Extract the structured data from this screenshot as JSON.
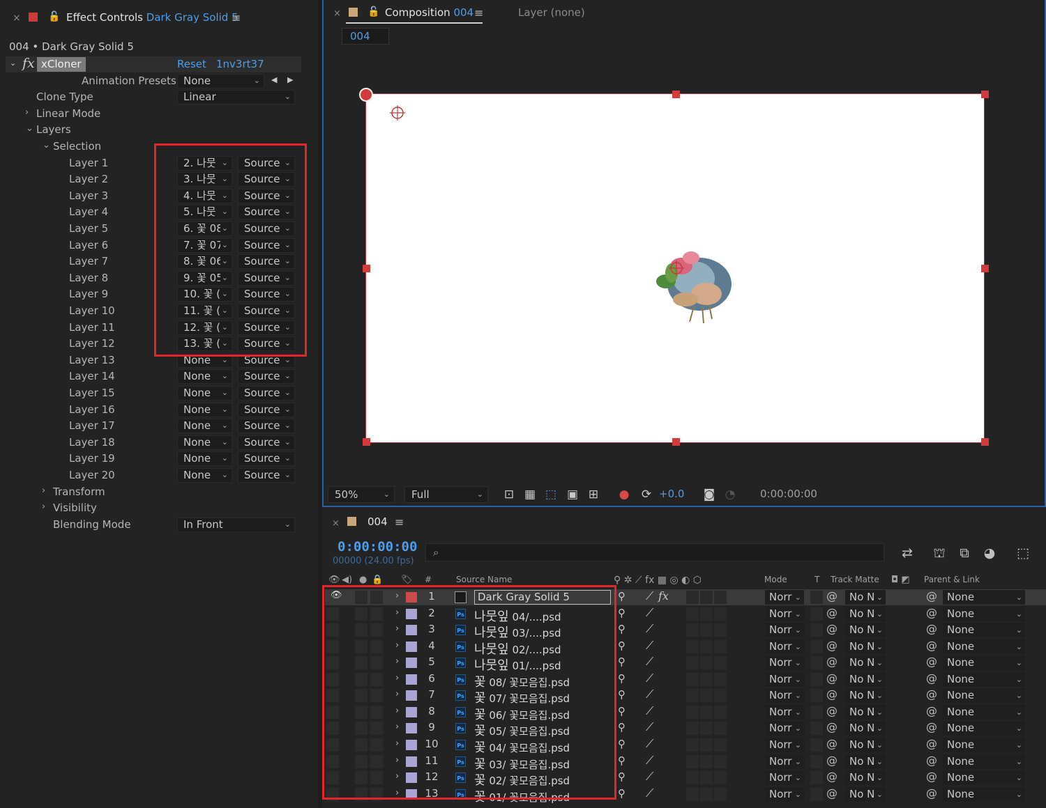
{
  "effect_controls": {
    "close": "×",
    "lock": "🔓",
    "title_prefix": "Effect Controls",
    "title_layer": "Dark Gray Solid 5",
    "menu": "≡",
    "subtitle": "004 • Dark Gray Solid 5",
    "effect": {
      "fx": "fx",
      "name": "xCloner",
      "reset": "Reset",
      "author": "1nv3rt37"
    },
    "animation_presets": {
      "label": "Animation Presets:",
      "value": "None"
    },
    "clone_type": {
      "label": "Clone Type",
      "value": "Linear"
    },
    "linear_mode": "Linear Mode",
    "layers_group": "Layers",
    "selection_group": "Selection",
    "layers": [
      {
        "label": "Layer 1",
        "layer": "2. 나뭇",
        "source": "Source"
      },
      {
        "label": "Layer 2",
        "layer": "3. 나뭇",
        "source": "Source"
      },
      {
        "label": "Layer 3",
        "layer": "4. 나뭇",
        "source": "Source"
      },
      {
        "label": "Layer 4",
        "layer": "5. 나뭇",
        "source": "Source"
      },
      {
        "label": "Layer 5",
        "layer": "6. 꽃 08",
        "source": "Source"
      },
      {
        "label": "Layer 6",
        "layer": "7. 꽃 07",
        "source": "Source"
      },
      {
        "label": "Layer 7",
        "layer": "8. 꽃 06",
        "source": "Source"
      },
      {
        "label": "Layer 8",
        "layer": "9. 꽃 05",
        "source": "Source"
      },
      {
        "label": "Layer 9",
        "layer": "10. 꽃 (",
        "source": "Source"
      },
      {
        "label": "Layer 10",
        "layer": "11. 꽃 (",
        "source": "Source"
      },
      {
        "label": "Layer 11",
        "layer": "12. 꽃 (",
        "source": "Source"
      },
      {
        "label": "Layer 12",
        "layer": "13. 꽃 (",
        "source": "Source"
      },
      {
        "label": "Layer 13",
        "layer": "None",
        "source": "Source"
      },
      {
        "label": "Layer 14",
        "layer": "None",
        "source": "Source"
      },
      {
        "label": "Layer 15",
        "layer": "None",
        "source": "Source"
      },
      {
        "label": "Layer 16",
        "layer": "None",
        "source": "Source"
      },
      {
        "label": "Layer 17",
        "layer": "None",
        "source": "Source"
      },
      {
        "label": "Layer 18",
        "layer": "None",
        "source": "Source"
      },
      {
        "label": "Layer 19",
        "layer": "None",
        "source": "Source"
      },
      {
        "label": "Layer 20",
        "layer": "None",
        "source": "Source"
      }
    ],
    "transform": "Transform",
    "visibility": "Visibility",
    "blending_mode": {
      "label": "Blending Mode",
      "value": "In Front"
    }
  },
  "composition": {
    "close": "×",
    "lock": "🔓",
    "title_prefix": "Composition",
    "title_comp": "004",
    "menu": "≡",
    "layer_tab": "Layer (none)",
    "breadcrumb": "004",
    "zoom": "50%",
    "resolution": "Full",
    "exposure": "+0.0",
    "timecode": "0:00:00:00"
  },
  "timeline": {
    "close": "×",
    "comp_name": "004",
    "menu": "≡",
    "timecode": "0:00:00:00",
    "frame_fps": "00000 (24.00 fps)",
    "search_icon": "⌕",
    "columns": {
      "hash": "#",
      "source_name": "Source Name",
      "mode": "Mode",
      "t": "T",
      "track_matte": "Track Matte",
      "parent_link": "Parent & Link"
    },
    "rows": [
      {
        "num": "1",
        "name": "Dark Gray Solid 5",
        "kind": "solid",
        "mode": "Norr",
        "matte": "No N",
        "parent": "None",
        "label_color": "#c94b4b"
      },
      {
        "num": "2",
        "name_big": "나뭇잎",
        "name": " 04/....psd",
        "kind": "psd",
        "mode": "Norr",
        "matte": "No N",
        "parent": "None",
        "label_color": "#a9a6d6"
      },
      {
        "num": "3",
        "name_big": "나뭇잎",
        "name": " 03/....psd",
        "kind": "psd",
        "mode": "Norr",
        "matte": "No N",
        "parent": "None",
        "label_color": "#a9a6d6"
      },
      {
        "num": "4",
        "name_big": "나뭇잎",
        "name": " 02/....psd",
        "kind": "psd",
        "mode": "Norr",
        "matte": "No N",
        "parent": "None",
        "label_color": "#a9a6d6"
      },
      {
        "num": "5",
        "name_big": "나뭇잎",
        "name": " 01/....psd",
        "kind": "psd",
        "mode": "Norr",
        "matte": "No N",
        "parent": "None",
        "label_color": "#a9a6d6"
      },
      {
        "num": "6",
        "name_big": "꽃",
        "name": " 08/ 꽃모음집.psd",
        "kind": "psd",
        "mode": "Norr",
        "matte": "No N",
        "parent": "None",
        "label_color": "#a9a6d6"
      },
      {
        "num": "7",
        "name_big": "꽃",
        "name": " 07/ 꽃모음집.psd",
        "kind": "psd",
        "mode": "Norr",
        "matte": "No N",
        "parent": "None",
        "label_color": "#a9a6d6"
      },
      {
        "num": "8",
        "name_big": "꽃",
        "name": " 06/ 꽃모음집.psd",
        "kind": "psd",
        "mode": "Norr",
        "matte": "No N",
        "parent": "None",
        "label_color": "#a9a6d6"
      },
      {
        "num": "9",
        "name_big": "꽃",
        "name": " 05/ 꽃모음집.psd",
        "kind": "psd",
        "mode": "Norr",
        "matte": "No N",
        "parent": "None",
        "label_color": "#a9a6d6"
      },
      {
        "num": "10",
        "name_big": "꽃",
        "name": " 04/ 꽃모음집.psd",
        "kind": "psd",
        "mode": "Norr",
        "matte": "No N",
        "parent": "None",
        "label_color": "#a9a6d6"
      },
      {
        "num": "11",
        "name_big": "꽃",
        "name": " 03/ 꽃모음집.psd",
        "kind": "psd",
        "mode": "Norr",
        "matte": "No N",
        "parent": "None",
        "label_color": "#a9a6d6"
      },
      {
        "num": "12",
        "name_big": "꽃",
        "name": " 02/ 꽃모음집.psd",
        "kind": "psd",
        "mode": "Norr",
        "matte": "No N",
        "parent": "None",
        "label_color": "#a9a6d6"
      },
      {
        "num": "13",
        "name_big": "꽃",
        "name": " 01/ 꽃모음집.psd",
        "kind": "psd",
        "mode": "Norr",
        "matte": "No N",
        "parent": "None",
        "label_color": "#a9a6d6"
      }
    ]
  },
  "colors": {
    "accent_blue": "#4d9ee8",
    "highlight_red": "#e3262b",
    "panel_bg": "#232323"
  }
}
